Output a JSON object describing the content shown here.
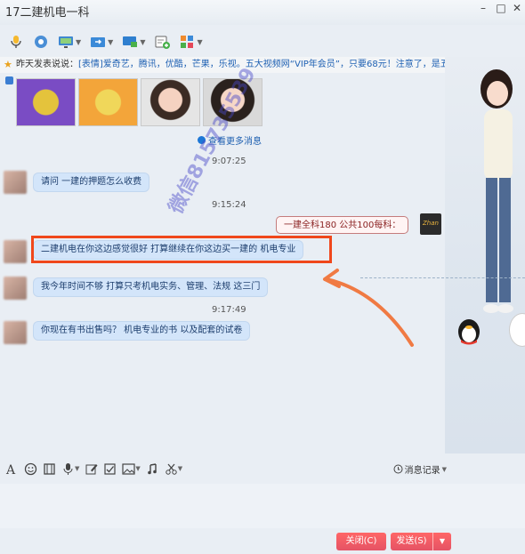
{
  "window": {
    "title": "17二建机电一科"
  },
  "announcement": {
    "prefix": "昨天发表说说：",
    "text": "[表情]爱奇艺，腾讯，优酷，芒果，乐视。五大视频网“VIP年会员”，只要68元！注意了，是五大..."
  },
  "chat": {
    "more_messages": "查看更多消息",
    "messages": [
      {
        "time": "9:07:25"
      },
      {
        "text": "请问 一建的押题怎么收费"
      },
      {
        "time": "9:15:24"
      },
      {
        "text": "一建全科180 公共100每科："
      },
      {
        "text": "二建机电在你这边感觉很好  打算继续在你这边买一建的  机电专业"
      },
      {
        "text": "我今年时间不够   打算只考机电实务、管理、法规 这三门"
      },
      {
        "text": "你现在有书出售吗？  机电专业的书  以及配套的试卷"
      }
    ],
    "partial_time": "9:17:49",
    "watermark": "微信815735539"
  },
  "input": {
    "history_label": "消息记录",
    "close_label": "关闭(C)",
    "send_label": "发送(S)"
  },
  "colors": {
    "accent_red": "#e55365",
    "highlight_red": "#f0471b",
    "bubble": "#d3e5fa",
    "link_blue": "#1d5fb0"
  }
}
